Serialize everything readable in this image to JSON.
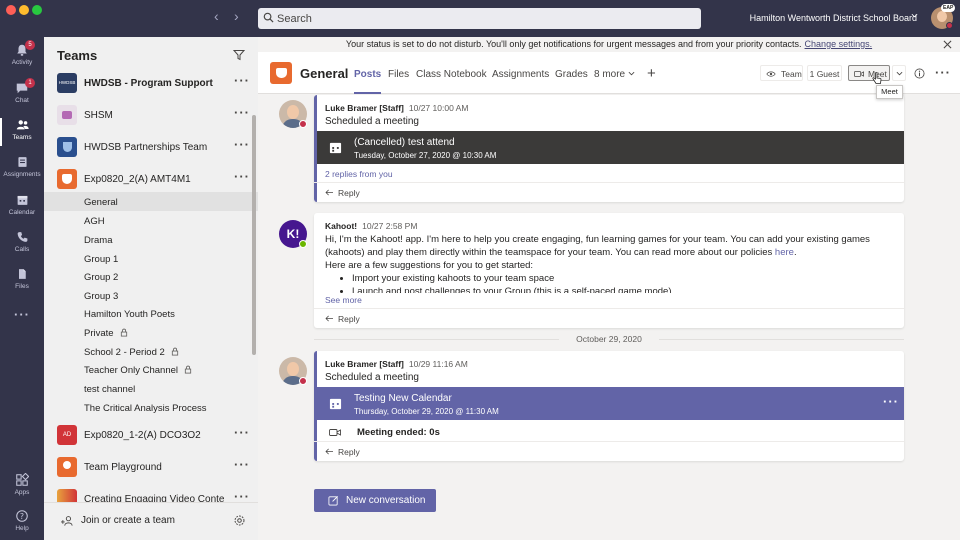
{
  "app": {
    "search_placeholder": "Search",
    "org_name": "Hamilton Wentworth District School Board",
    "avatar_badge": "EAP",
    "colors": {
      "titlebar": "#33344a",
      "accent": "#6264a7",
      "busy": "#c4314b",
      "available": "#6bb700"
    }
  },
  "rail": [
    {
      "label": "Activity",
      "icon": "bell-icon",
      "badge": "5"
    },
    {
      "label": "Chat",
      "icon": "chat-icon",
      "badge": "1"
    },
    {
      "label": "Teams",
      "icon": "teams-icon",
      "active": true
    },
    {
      "label": "Assignments",
      "icon": "assignments-icon"
    },
    {
      "label": "Calendar",
      "icon": "calendar-icon"
    },
    {
      "label": "Calls",
      "icon": "phone-icon"
    },
    {
      "label": "Files",
      "icon": "file-icon"
    },
    {
      "label": "Apps",
      "icon": "apps-icon"
    },
    {
      "label": "Help",
      "icon": "help-icon"
    }
  ],
  "teams_panel": {
    "title": "Teams",
    "teams": [
      {
        "name": "HWDSB - Program Support",
        "logo_text": "HWDSB",
        "bold": true
      },
      {
        "name": "SHSM",
        "logo_text": ""
      },
      {
        "name": "HWDSB Partnerships Team",
        "logo_text": ""
      },
      {
        "name": "Exp0820_2(A) AMT4M1",
        "logo_text": ""
      }
    ],
    "channels": [
      {
        "name": "General",
        "selected": true
      },
      {
        "name": "AGH"
      },
      {
        "name": "Drama"
      },
      {
        "name": "Group 1"
      },
      {
        "name": "Group 2"
      },
      {
        "name": "Group 3"
      },
      {
        "name": "Hamilton Youth Poets"
      },
      {
        "name": "Private",
        "locked": true
      },
      {
        "name": "School 2 - Period 2",
        "locked": true
      },
      {
        "name": "Teacher Only Channel",
        "locked": true
      },
      {
        "name": "test channel"
      },
      {
        "name": "The Critical Analysis Process"
      }
    ],
    "teams_after": [
      {
        "name": "Exp0820_1-2(A) DCO3O2",
        "logo_text": "AD"
      },
      {
        "name": "Team Playground",
        "logo_text": ""
      },
      {
        "name": "Creating Engaging Video Conte",
        "logo_text": ""
      }
    ],
    "join_label": "Join or create a team"
  },
  "banner": {
    "text": "Your status is set to do not disturb. You'll only get notifications for urgent messages and from your priority contacts.",
    "link": "Change settings."
  },
  "channel_header": {
    "title": "General",
    "tabs": [
      "Posts",
      "Files",
      "Class Notebook",
      "Assignments",
      "Grades",
      "8 more"
    ],
    "team_btn": "Team",
    "guest_btn": "1 Guest",
    "meet_btn": "Meet",
    "tooltip": "Meet"
  },
  "messages": {
    "m1": {
      "author": "Luke Bramer [Staff]",
      "time": "10/27 10:00 AM",
      "text": "Scheduled a meeting",
      "meeting_title": "(Cancelled) test attend",
      "meeting_date": "Tuesday, October 27, 2020 @ 10:30 AM",
      "replies": "2 replies from you",
      "reply": "Reply"
    },
    "m2": {
      "author": "Kahoot!",
      "time": "10/27 2:58 PM",
      "text_intro": "Hi, I'm the Kahoot! app. I'm here to help you create engaging, fun learning games for your team. You can add your existing games (kahoots) and play them directly within the teamspace for your team. You can read more about our policies",
      "link": "here",
      "suggestions_intro": "Here are a few suggestions for you to get started:",
      "bullets": [
        "Import your existing kahoots to your team space",
        "Launch and post challenges to your Group (this is a self-paced game mode)"
      ],
      "see_more": "See more",
      "reply": "Reply"
    },
    "divider": "October 29, 2020",
    "m3": {
      "author": "Luke Bramer [Staff]",
      "time": "10/29 11:16 AM",
      "text": "Scheduled a meeting",
      "meeting_title": "Testing New Calendar",
      "meeting_date": "Thursday, October 29, 2020 @ 11:30 AM",
      "ended": "Meeting ended: 0s",
      "reply": "Reply"
    }
  },
  "new_conversation": "New conversation"
}
